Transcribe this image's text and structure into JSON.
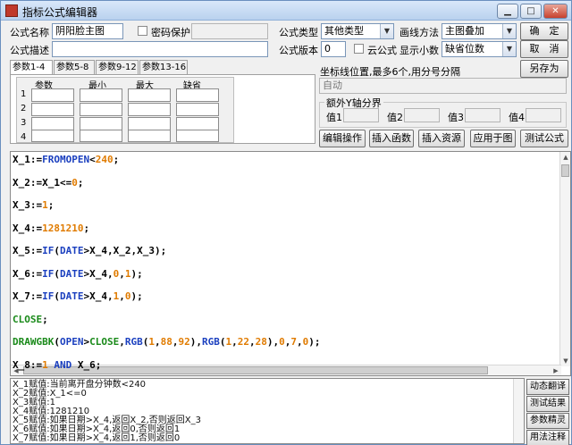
{
  "window": {
    "title": "指标公式编辑器",
    "controls": {
      "minimize": "▁",
      "maximize": "□",
      "close": "✕"
    }
  },
  "form": {
    "name_label": "公式名称",
    "name_value": "阴阳脸主图",
    "password_label": "密码保护",
    "type_label": "公式类型",
    "type_value": "其他类型",
    "draw_label": "画线方法",
    "draw_value": "主图叠加",
    "desc_label": "公式描述",
    "desc_value": "",
    "version_label": "公式版本",
    "version_value": "0",
    "cloud_label": "云公式",
    "decimals_label": "显示小数",
    "decimals_value": "缺省位数",
    "ok_label": "确　定",
    "cancel_label": "取　消",
    "saveas_label": "另存为"
  },
  "params": {
    "tabs": [
      "参数1-4",
      "参数5-8",
      "参数9-12",
      "参数13-16"
    ],
    "headers": [
      "参数",
      "最小",
      "最大",
      "缺省"
    ],
    "rows": [
      "1",
      "2",
      "3",
      "4"
    ]
  },
  "coord": {
    "label": "坐标线位置,最多6个,用分号分隔",
    "value": "自动"
  },
  "yaxis": {
    "title": "额外Y轴分界",
    "labels": [
      "值1",
      "值2",
      "值3",
      "值4"
    ]
  },
  "actions": [
    "编辑操作",
    "插入函数",
    "插入资源",
    "应用于图",
    "测试公式"
  ],
  "code": [
    [
      [
        "X_1:=",
        "var"
      ],
      [
        "FROMOPEN",
        "fn"
      ],
      [
        "<",
        "op"
      ],
      [
        "240",
        "num"
      ],
      [
        ";",
        "op"
      ]
    ],
    [
      [
        "X_2:=X_1<=",
        "var"
      ],
      [
        "0",
        "num"
      ],
      [
        ";",
        "op"
      ]
    ],
    [
      [
        "X_3:=",
        "var"
      ],
      [
        "1",
        "num"
      ],
      [
        ";",
        "op"
      ]
    ],
    [
      [
        "X_4:=",
        "var"
      ],
      [
        "1281210",
        "num"
      ],
      [
        ";",
        "op"
      ]
    ],
    [
      [
        "X_5:=",
        "var"
      ],
      [
        "IF",
        "fn"
      ],
      [
        "(",
        "op"
      ],
      [
        "DATE",
        "fn"
      ],
      [
        ">X_4,X_2,X_3);",
        "op"
      ]
    ],
    [
      [
        "X_6:=",
        "var"
      ],
      [
        "IF",
        "fn"
      ],
      [
        "(",
        "op"
      ],
      [
        "DATE",
        "fn"
      ],
      [
        ">X_4,",
        "op"
      ],
      [
        "0",
        "num"
      ],
      [
        ",",
        "op"
      ],
      [
        "1",
        "num"
      ],
      [
        ");",
        "op"
      ]
    ],
    [
      [
        "X_7:=",
        "var"
      ],
      [
        "IF",
        "fn"
      ],
      [
        "(",
        "op"
      ],
      [
        "DATE",
        "fn"
      ],
      [
        ">X_4,",
        "op"
      ],
      [
        "1",
        "num"
      ],
      [
        ",",
        "op"
      ],
      [
        "0",
        "num"
      ],
      [
        ");",
        "op"
      ]
    ],
    [
      [
        "CLOSE",
        "kw"
      ],
      [
        ";",
        "op"
      ]
    ],
    [
      [
        "DRAWGBK",
        "kw"
      ],
      [
        "(",
        "op"
      ],
      [
        "OPEN",
        "fn"
      ],
      [
        ">",
        "op"
      ],
      [
        "CLOSE",
        "kw"
      ],
      [
        ",",
        "op"
      ],
      [
        "RGB",
        "fn"
      ],
      [
        "(",
        "op"
      ],
      [
        "1",
        "num"
      ],
      [
        ",",
        "op"
      ],
      [
        "88",
        "num"
      ],
      [
        ",",
        "op"
      ],
      [
        "92",
        "num"
      ],
      [
        "),",
        "op"
      ],
      [
        "RGB",
        "fn"
      ],
      [
        "(",
        "op"
      ],
      [
        "1",
        "num"
      ],
      [
        ",",
        "op"
      ],
      [
        "22",
        "num"
      ],
      [
        ",",
        "op"
      ],
      [
        "28",
        "num"
      ],
      [
        "),",
        "op"
      ],
      [
        "0",
        "num"
      ],
      [
        ",",
        "op"
      ],
      [
        "7",
        "num"
      ],
      [
        ",",
        "op"
      ],
      [
        "0",
        "num"
      ],
      [
        ");",
        "op"
      ]
    ],
    [
      [
        "X_8:=",
        "var"
      ],
      [
        "1",
        "num"
      ],
      [
        " AND ",
        "fn"
      ],
      [
        "X_6;",
        "var"
      ]
    ]
  ],
  "output_lines": [
    "X_1赋值:当前离开盘分钟数<240",
    "X_2赋值:X_1<=0",
    "X_3赋值:1",
    "X_4赋值:1281210",
    "X_5赋值:如果日期>X_4,返回X_2,否则返回X_3",
    "X_6赋值:如果日期>X_4,返回0,否则返回1",
    "X_7赋值:如果日期>X_4,返回1,否则返回0"
  ],
  "side_buttons": [
    "动态翻译",
    "测试结果",
    "参数精灵",
    "用法注释"
  ],
  "colors": {
    "fn": "#1a3fbf",
    "num": "#e07b00",
    "kw": "#1a8a1a"
  }
}
